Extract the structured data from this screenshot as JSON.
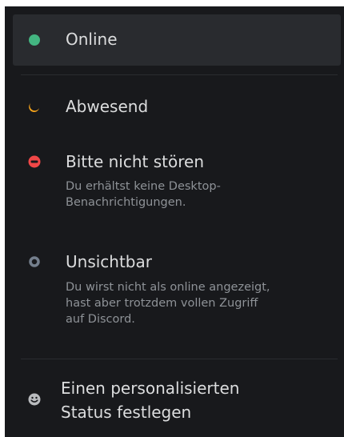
{
  "colors": {
    "background": "#18191c",
    "selected_bg": "#292b2f",
    "online": "#43b581",
    "idle": "#faa61a",
    "dnd": "#f04747",
    "invisible": "#747f8d",
    "label": "#dcddde",
    "description": "#8e9297"
  },
  "status_menu": {
    "items": [
      {
        "label": "Online",
        "icon": "online-dot-icon",
        "selected": true
      },
      {
        "label": "Abwesend",
        "icon": "moon-icon"
      },
      {
        "label": "Bitte nicht stören",
        "icon": "do-not-disturb-icon",
        "description_lines": [
          "Du erhältst keine Desktop-",
          "Benachrichtigungen."
        ]
      },
      {
        "label": "Unsichtbar",
        "icon": "invisible-ring-icon",
        "description_lines": [
          "Du wirst nicht als online angezeigt,",
          "hast aber trotzdem vollen Zugriff",
          "auf Discord."
        ]
      }
    ],
    "custom_status": {
      "label_lines": [
        "Einen personalisierten",
        "Status festlegen"
      ],
      "icon": "smiley-icon"
    }
  }
}
